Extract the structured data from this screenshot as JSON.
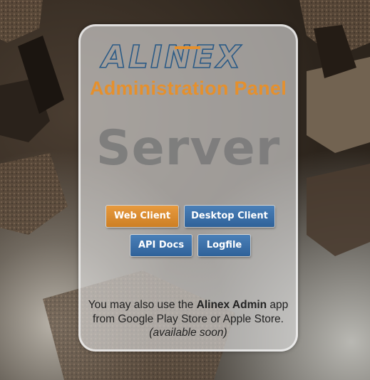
{
  "logo": {
    "text": "ALINEX",
    "colors": {
      "outline": "#2a5a86",
      "accent": "#e5902d"
    }
  },
  "header": {
    "title": "Administration Panel",
    "subtitle": "Server"
  },
  "buttons": {
    "web_client": "Web Client",
    "desktop_client": "Desktop Client",
    "api_docs": "API Docs",
    "logfile": "Logfile"
  },
  "info": {
    "line1_prefix": "You may also use the ",
    "app_name": "Alinex Admin",
    "line1_suffix": " app",
    "line2": "from Google Play Store or Apple Store.",
    "line3": "(available soon)"
  },
  "colors": {
    "orange": "#e5902d",
    "blue": "#3a6ea5",
    "panel": "#e1e1e1"
  }
}
